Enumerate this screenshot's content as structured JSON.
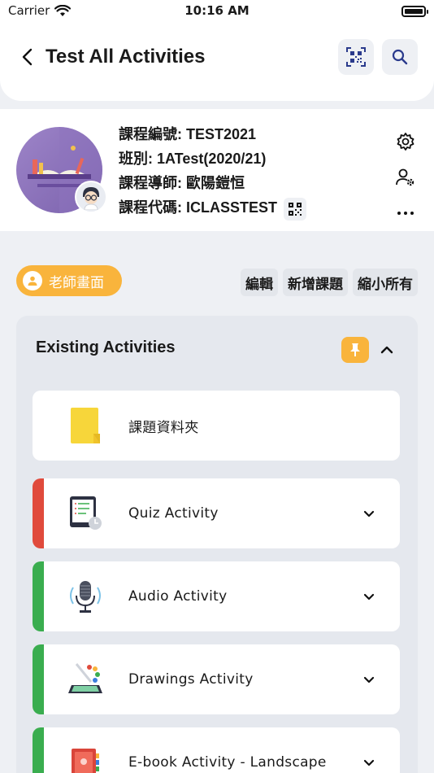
{
  "status": {
    "carrier": "Carrier",
    "time": "10:16 AM"
  },
  "header": {
    "title": "Test All Activities",
    "qr_icon": "qr-code-icon",
    "search_icon": "search-icon"
  },
  "course": {
    "code_label": "課程編號: TEST2021",
    "class_label": "班別: 1ATest(2020/21)",
    "teacher_label": "課程導師: 歐陽鎧恒",
    "course_code_label": "課程代碼: ICLASSTEST"
  },
  "toolbar": {
    "teacher_view": "老師畫面",
    "edit": "編輯",
    "add_topic": "新增課題",
    "collapse_all": "縮小所有"
  },
  "panel": {
    "title": "Existing Activities",
    "items": [
      {
        "label": "課題資料夾",
        "icon": "folder-icon",
        "accent": ""
      },
      {
        "label": "Quiz Activity",
        "icon": "quiz-icon",
        "accent": "#e04a3c"
      },
      {
        "label": "Audio Activity",
        "icon": "microphone-icon",
        "accent": "#3aad4f"
      },
      {
        "label": "Drawings Activity",
        "icon": "drawing-icon",
        "accent": "#3aad4f"
      },
      {
        "label": "E-book Activity - Landscape",
        "icon": "ebook-icon",
        "accent": "#3aad4f"
      }
    ]
  },
  "colors": {
    "accent_orange": "#f9b43c",
    "quiz_red": "#e04a3c",
    "activity_green": "#3aad4f"
  }
}
